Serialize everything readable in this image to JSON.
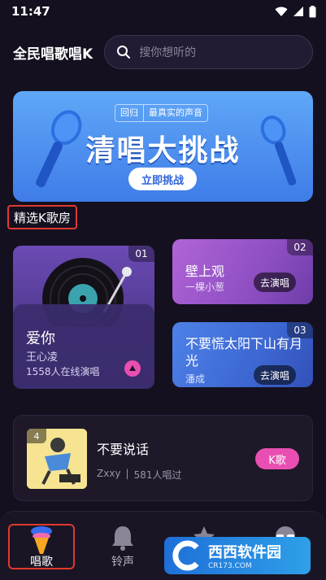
{
  "status_bar": {
    "time": "11:47"
  },
  "header": {
    "app_title": "全民唱歌唱K",
    "search_placeholder": "搜你想听的"
  },
  "banner": {
    "pill_left": "回归",
    "pill_right": "最真实的声音",
    "headline": "清唱大挑战",
    "cta": "立即挑战"
  },
  "section": {
    "title": "精选K歌房"
  },
  "rooms": [
    {
      "rank": "01",
      "title": "爱你",
      "singer": "王心凌",
      "online": "1558人在线演唱"
    },
    {
      "rank": "02",
      "title": "壁上观",
      "singer": "一棵小葱",
      "action": "去演唱"
    },
    {
      "rank": "03",
      "title": "不要慌太阳下山有月光",
      "singer": "潘成",
      "action": "去演唱"
    }
  ],
  "song": {
    "rank": "4",
    "title": "不要说话",
    "user": "Zxxy",
    "sep": "|",
    "count": "581人唱过",
    "button": "K歌"
  },
  "tabs": [
    {
      "label": "唱歌"
    },
    {
      "label": "铃声"
    },
    {
      "label": ""
    },
    {
      "label": ""
    }
  ],
  "watermark": {
    "text": "西西软件园",
    "sub": "CR173.COM"
  },
  "colors": {
    "accent_pink": "#e94fb2",
    "highlight_red": "#e0392f",
    "banner_blue": "#4a88ee"
  }
}
